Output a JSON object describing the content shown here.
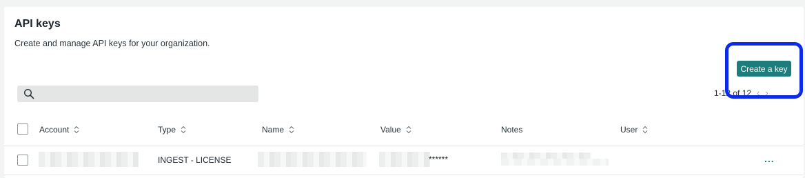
{
  "header": {
    "title": "API keys",
    "subtitle": "Create and manage API keys for your organization."
  },
  "toolbar": {
    "create_label": "Create a key",
    "search_placeholder": "",
    "pagination_text": "1-12 of 12",
    "prev_icon": "chevron-left-icon",
    "next_icon": "chevron-right-icon"
  },
  "table": {
    "columns": [
      "Account",
      "Type",
      "Name",
      "Value",
      "Notes",
      "User"
    ],
    "rows": [
      {
        "account": "",
        "type": "INGEST - LICENSE",
        "name": "",
        "value_suffix": "******",
        "notes": "",
        "user": "",
        "actions_label": "..."
      }
    ]
  },
  "colors": {
    "accent": "#1d7d7d",
    "highlight": "#0b2be8",
    "background": "#f2f3f3"
  }
}
